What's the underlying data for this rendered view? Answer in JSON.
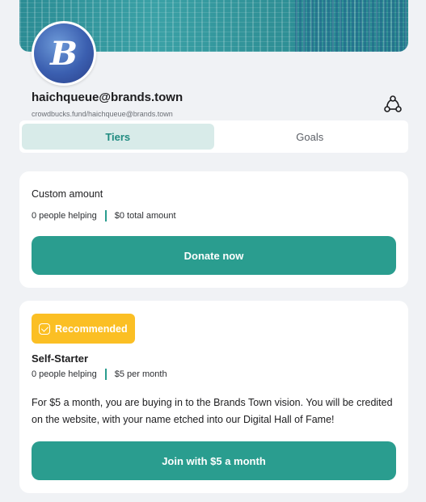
{
  "profile": {
    "handle": "haichqueue@brands.town",
    "url": "crowdbucks.fund/haichqueue@brands.town",
    "avatar_letter": "B"
  },
  "icons": {
    "share": "share-network-icon",
    "recommended": "check-square-icon"
  },
  "colors": {
    "accent": "#2a9d8f",
    "tab_active_bg": "#d8ebe9",
    "badge": "#fbbf24",
    "page_bg": "#f0f2f5"
  },
  "tabs": [
    {
      "label": "Tiers",
      "active": true
    },
    {
      "label": "Goals",
      "active": false
    }
  ],
  "custom_card": {
    "title": "Custom amount",
    "people": "0 people helping",
    "amount": "$0 total amount",
    "button": "Donate now"
  },
  "tier_card": {
    "badge": "Recommended",
    "name": "Self-Starter",
    "people": "0 people helping",
    "price": "$5 per month",
    "description": "For $5 a month, you are buying in to the Brands Town vision. You will be credited on the website, with your name etched into our Digital Hall of Fame!",
    "button": "Join with $5 a month"
  }
}
